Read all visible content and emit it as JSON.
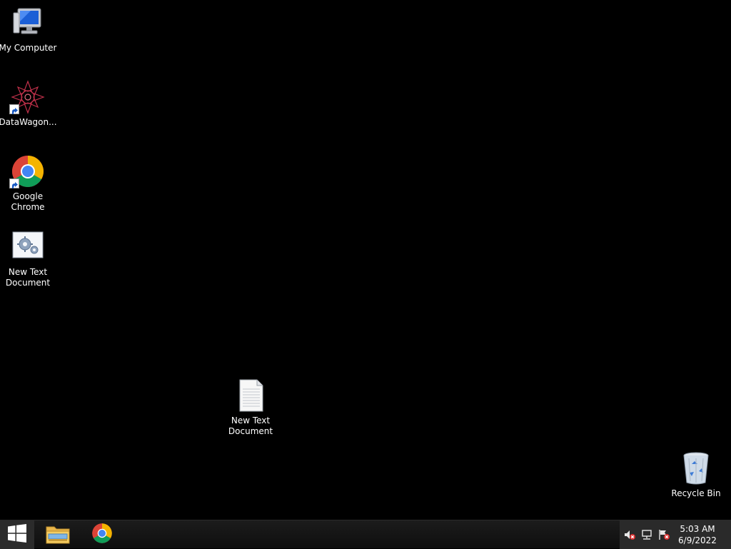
{
  "desktop": {
    "icons": [
      {
        "label": "My Computer",
        "icon": "computer-icon"
      },
      {
        "label": "DataWagon...",
        "icon": "datawagon-icon",
        "shortcut": true
      },
      {
        "label": "Google Chrome",
        "icon": "chrome-icon",
        "shortcut": true
      },
      {
        "label": "New Text Document",
        "icon": "settings-document-icon"
      },
      {
        "label": "New Text Document",
        "icon": "text-document-icon"
      },
      {
        "label": "Recycle Bin",
        "icon": "recycle-bin-icon"
      }
    ]
  },
  "taskbar": {
    "start": {
      "icon": "windows-logo-icon"
    },
    "pinned": [
      {
        "name": "File Explorer",
        "icon": "file-explorer-icon"
      },
      {
        "name": "Google Chrome",
        "icon": "chrome-icon"
      }
    ],
    "tray": {
      "icons": [
        "volume-muted-icon",
        "network-icon",
        "action-center-flag-icon"
      ],
      "time": "5:03 AM",
      "date": "6/9/2022"
    }
  },
  "colors": {
    "background": "#000000",
    "taskbar": "#161616",
    "tray": "#2a2a2a",
    "chrome_red": "#db4437",
    "chrome_green": "#0f9d58",
    "chrome_yellow": "#f4b400",
    "chrome_blue": "#4285f4"
  }
}
